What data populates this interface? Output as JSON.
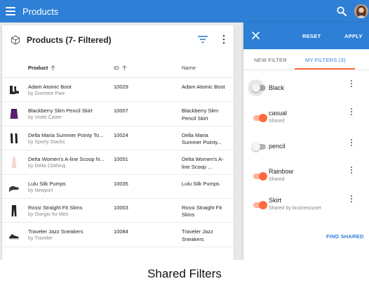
{
  "app_bar": {
    "title": "Products",
    "icons": [
      "menu-icon",
      "search-icon",
      "avatar"
    ]
  },
  "card": {
    "title": "Products (7- Filtered)",
    "icons": [
      "box-icon",
      "filter-icon",
      "more-vert-icon"
    ],
    "columns": {
      "product": "Product",
      "id": "ID",
      "name": "Name"
    },
    "rows": [
      {
        "name": "Adam Atomic Boot",
        "by": "by Gumtree Paw",
        "id": "10029",
        "name_col": "Adam Atomic Boot",
        "thumb": "boot",
        "thumb_color": "#2a2a2a"
      },
      {
        "name": "Blackberry Slim Pencil Skirt",
        "by": "by Violet Carter",
        "id": "10007",
        "name_col": "Blackberry Slim Pencil Skirt",
        "thumb": "skirt",
        "thumb_color": "#5b1f6e"
      },
      {
        "name": "Della Maria Summer Pointy To...",
        "by": "by Sporty Stacks",
        "id": "10024",
        "name_col": "Della Maria Summer Pointy...",
        "thumb": "pumps",
        "thumb_color": "#1d1d1d"
      },
      {
        "name": "Delta Women's A-line Scoop N...",
        "by": "by Delta Clothing",
        "id": "10051",
        "name_col": "Delta Women's A-line Scoop ...",
        "thumb": "dress",
        "thumb_color": "#f2d7cf"
      },
      {
        "name": "Lulu Silk Pumps",
        "by": "by Newport",
        "id": "10035",
        "name_col": "Lulu Silk Pumps",
        "thumb": "heel",
        "thumb_color": "#3a3a3a"
      },
      {
        "name": "Rossi Straight Fit Slims",
        "by": "by Giorgio for Men",
        "id": "10003",
        "name_col": "Rossi Straight Fit Slims",
        "thumb": "pants",
        "thumb_color": "#222222"
      },
      {
        "name": "Traveler Jazz Sneakers",
        "by": "by Traveler",
        "id": "10084",
        "name_col": "Traveler Jazz Sneakers",
        "thumb": "sneaker",
        "thumb_color": "#2b2b2b"
      }
    ]
  },
  "drawer": {
    "reset": "RESET",
    "apply": "APPLY",
    "tabs": {
      "new": "NEW FILTER",
      "mine": "MY FILTERS (3)"
    },
    "filters": [
      {
        "label": "Black",
        "sub": "",
        "on": false
      },
      {
        "label": "casual",
        "sub": "Shared",
        "on": true
      },
      {
        "label": "pencil",
        "sub": "",
        "on": false
      },
      {
        "label": "Rainbow",
        "sub": "Shared",
        "on": true
      },
      {
        "label": "Skirt",
        "sub": "Shared by businessuser",
        "on": true
      }
    ],
    "find_shared": "FIND SHARED"
  },
  "caption": "Shared Filters",
  "colors": {
    "primary": "#2e7fd6",
    "accent": "#ff6a3d"
  }
}
